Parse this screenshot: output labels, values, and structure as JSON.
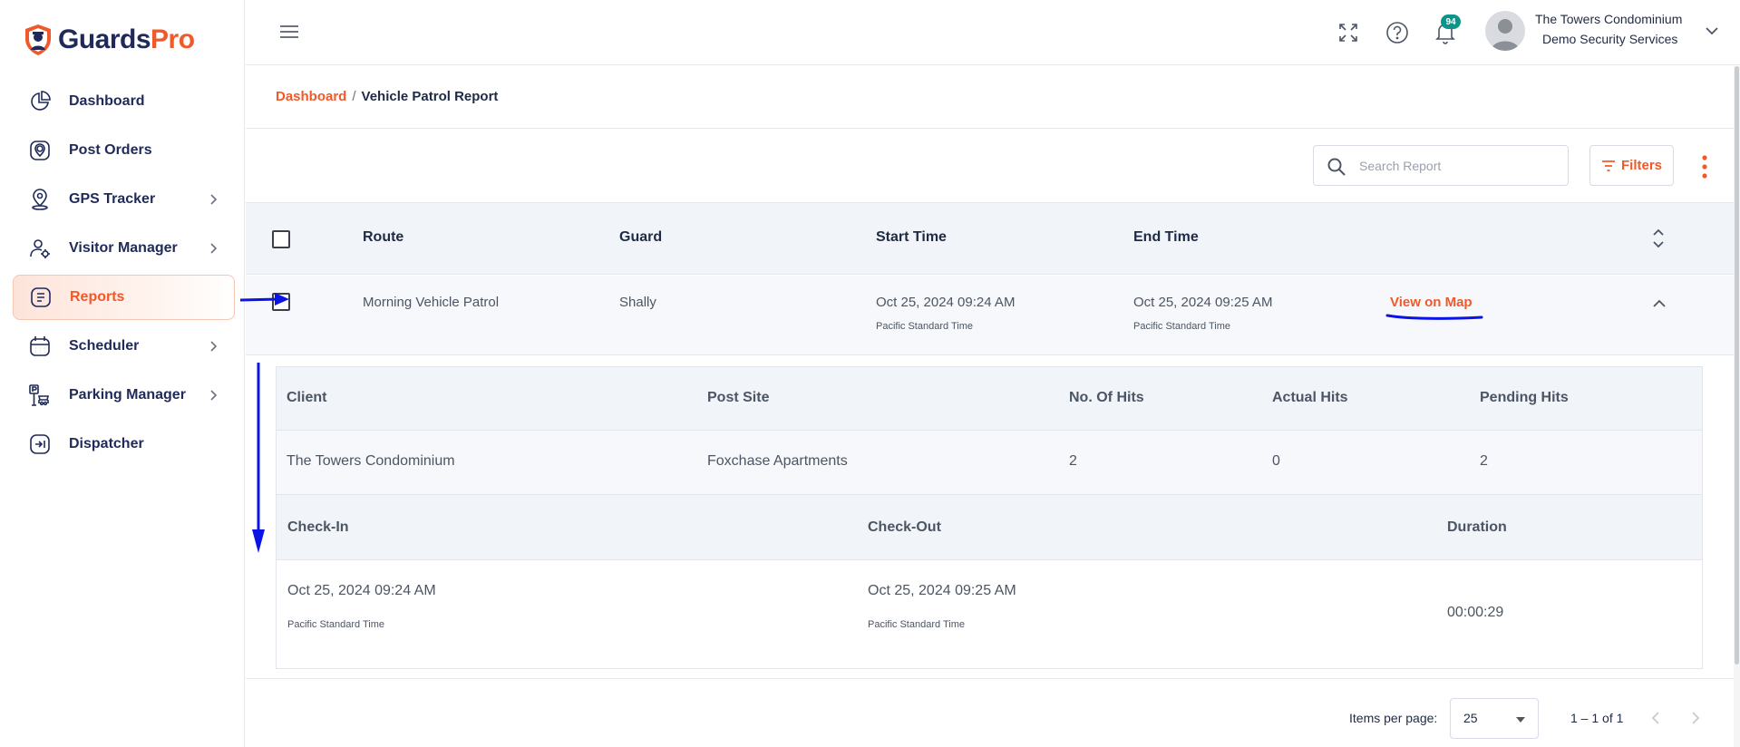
{
  "brand": {
    "part1": "Guards",
    "part2": "Pro",
    "primary_color": "#f0592a",
    "dark_color": "#1f2a5a"
  },
  "sidebar": {
    "items": [
      {
        "label": "Dashboard",
        "icon": "pie-chart-icon",
        "has_children": false,
        "active": false
      },
      {
        "label": "Post Orders",
        "icon": "pin-icon",
        "has_children": false,
        "active": false
      },
      {
        "label": "GPS Tracker",
        "icon": "map-pin-icon",
        "has_children": true,
        "active": false
      },
      {
        "label": "Visitor Manager",
        "icon": "user-settings-icon",
        "has_children": true,
        "active": false
      },
      {
        "label": "Reports",
        "icon": "document-icon",
        "has_children": false,
        "active": true
      },
      {
        "label": "Scheduler",
        "icon": "calendar-icon",
        "has_children": true,
        "active": false
      },
      {
        "label": "Parking Manager",
        "icon": "parking-icon",
        "has_children": true,
        "active": false
      },
      {
        "label": "Dispatcher",
        "icon": "dispatch-icon",
        "has_children": false,
        "active": false
      }
    ]
  },
  "topbar": {
    "notification_count": "94",
    "user": {
      "name": "The Towers Condominium",
      "org": "Demo Security Services"
    }
  },
  "breadcrumb": {
    "link": "Dashboard",
    "separator": "/",
    "current": "Vehicle Patrol Report"
  },
  "toolbar": {
    "search_placeholder": "Search Report",
    "filters_label": "Filters"
  },
  "table": {
    "headers": {
      "route": "Route",
      "guard": "Guard",
      "start": "Start Time",
      "end": "End Time"
    },
    "row": {
      "route": "Morning Vehicle Patrol",
      "guard": "Shally",
      "start": "Oct 25, 2024 09:24 AM",
      "start_tz": "Pacific Standard Time",
      "end": "Oct 25, 2024 09:25 AM",
      "end_tz": "Pacific Standard Time",
      "action": "View on Map"
    }
  },
  "detail": {
    "headers1": {
      "client": "Client",
      "post_site": "Post Site",
      "hits": "No. Of Hits",
      "actual": "Actual Hits",
      "pending": "Pending Hits"
    },
    "values1": {
      "client": "The Towers Condominium",
      "post_site": "Foxchase Apartments",
      "hits": "2",
      "actual": "0",
      "pending": "2"
    },
    "headers2": {
      "check_in": "Check-In",
      "check_out": "Check-Out",
      "duration": "Duration"
    },
    "values2": {
      "check_in": "Oct 25, 2024 09:24 AM",
      "check_in_tz": "Pacific Standard Time",
      "check_out": "Oct 25, 2024 09:25 AM",
      "check_out_tz": "Pacific Standard Time",
      "duration": "00:00:29"
    }
  },
  "pagination": {
    "items_per_page_label": "Items per page:",
    "items_per_page": "25",
    "range": "1 – 1 of 1"
  },
  "annotation_color": "#0a14e6"
}
